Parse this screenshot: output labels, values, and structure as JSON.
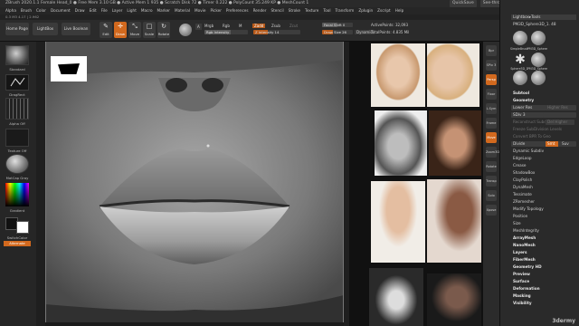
{
  "window": {
    "title": "ZBrush 2020.1.1   Female Head_0   ● Free Mem 3.10 GB ● Active Mem 1 935 ● Scratch Disk 72 ● Timer 0.222 ● PolyCount 35.249 KP ● MeshCount 1",
    "quicksave": "QuickSave",
    "seethrough": "See-through  0",
    "menus": "Menus",
    "script": "DefaultZScript"
  },
  "menubar": [
    "Alpha",
    "Brush",
    "Color",
    "Document",
    "Draw",
    "Edit",
    "File",
    "Layer",
    "Light",
    "Macro",
    "Marker",
    "Material",
    "Movie",
    "Picker",
    "Preferences",
    "Render",
    "Stencil",
    "Stroke",
    "Texture",
    "Tool",
    "Transform",
    "Zplugin",
    "Zscript",
    "Help"
  ],
  "infobar": "0.3 M3  4.17 | 2.962",
  "toolshelf": {
    "home_page": "Home Page",
    "lightbox": "LightBox",
    "live_boolean": "Live Boolean",
    "modes": [
      {
        "icon": "✎",
        "label": "Edit"
      },
      {
        "icon": "✛",
        "label": "Draw"
      },
      {
        "icon": "⤡",
        "label": "Move"
      },
      {
        "icon": "□",
        "label": "Scale"
      },
      {
        "icon": "↻",
        "label": "Rotate"
      }
    ],
    "mrgb": "Mrgb",
    "rgb": "Rgb",
    "m": "M",
    "zadd": "Zadd",
    "zsub": "Zsub",
    "zcut": "Zcut",
    "rgb_intensity": "Rgb Intensity",
    "z_intensity": "Z Intensity 14",
    "focal_shift": "Focal Shift 0",
    "draw_size": "Draw Size 26",
    "dynamic": "Dynamic",
    "active_points": "ActivePoints: 32,093",
    "total_points": "TotalPoints: 4.835 Mil"
  },
  "leftshelf": {
    "brush": "Standard",
    "stroke": "DragRect",
    "alpha": "Alpha Off",
    "texture": "Texture Off",
    "material": "MatCap Gray",
    "gradient": "Gradient",
    "switch_color": "SwitchColor",
    "alternate": "Alternate"
  },
  "side_icons": [
    "Bpr",
    "SPix 3",
    "Persp",
    "Floor",
    "L.Sym",
    "Frame",
    "Move",
    "Zoom3D",
    "Rotate",
    "Transp",
    "Solo",
    "Xpose"
  ],
  "rpanel": {
    "lightbox_tools": "Lightbox▸Tools",
    "subtool_name": "PM3D_Sphere3D_1. 48",
    "tool_labels": [
      "SimpleBrush",
      "PM3D_Sphere3D",
      "Sphere3D_1",
      "PM3D_Sphere3D"
    ],
    "items": [
      {
        "t": "Subtool",
        "k": "hdr"
      },
      {
        "t": "Geometry",
        "k": "hdr"
      },
      {
        "t": "Lower Res",
        "k": "btn"
      },
      {
        "t": "Del Lower",
        "k": "btn"
      },
      {
        "t": "Reconstruct Subdiv",
        "k": "dim"
      },
      {
        "t": "Freeze SubDivision Levels",
        "k": "dim"
      },
      {
        "t": "Convert BPR To Geo",
        "k": "dim"
      },
      {
        "t": "Divide",
        "k": "btn"
      },
      {
        "t": "Dynamic Subdiv",
        "k": ""
      },
      {
        "t": "EdgeLoop",
        "k": ""
      },
      {
        "t": "Crease",
        "k": ""
      },
      {
        "t": "ShadowBox",
        "k": ""
      },
      {
        "t": "ClayPolish",
        "k": ""
      },
      {
        "t": "DynaMesh",
        "k": ""
      },
      {
        "t": "Tessimate",
        "k": ""
      },
      {
        "t": "ZRemesher",
        "k": ""
      },
      {
        "t": "Modify Topology",
        "k": ""
      },
      {
        "t": "Position",
        "k": ""
      },
      {
        "t": "Size",
        "k": ""
      },
      {
        "t": "MeshIntegrity",
        "k": ""
      },
      {
        "t": "ArrayMesh",
        "k": "hdr"
      },
      {
        "t": "NanoMesh",
        "k": "hdr"
      },
      {
        "t": "Layers",
        "k": "hdr"
      },
      {
        "t": "FiberMesh",
        "k": "hdr"
      },
      {
        "t": "Geometry HD",
        "k": "hdr"
      },
      {
        "t": "Preview",
        "k": "hdr"
      },
      {
        "t": "Surface",
        "k": "hdr"
      },
      {
        "t": "Deformation",
        "k": "hdr"
      },
      {
        "t": "Masking",
        "k": "hdr"
      },
      {
        "t": "Visibility",
        "k": "hdr"
      }
    ],
    "higher_res": "Higher Res",
    "sdiv": "SDiv 3",
    "del_higher": "Del Higher",
    "smt": "Smt",
    "suv": "Suv"
  },
  "logo": "3dermy"
}
